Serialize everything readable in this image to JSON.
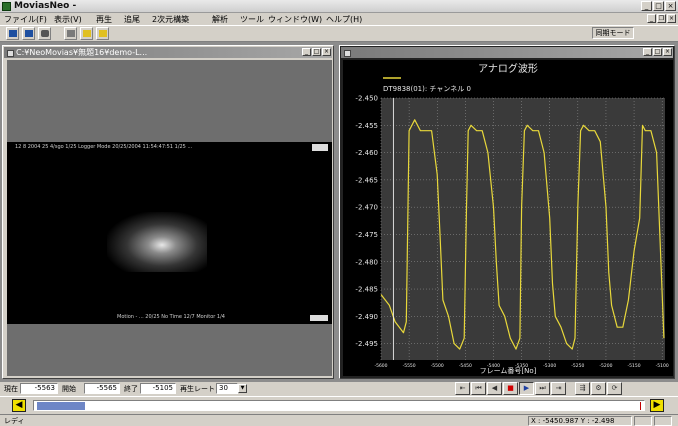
{
  "app": {
    "title": "MoviasNeo -"
  },
  "menubar": {
    "items": [
      "ファイル(F)",
      "表示(V)",
      "再生",
      "追尾",
      "2次元構築",
      "解析",
      "ツール",
      "ウィンドウ(W)",
      "ヘルプ(H)"
    ]
  },
  "toolbar": {
    "sync_mode": "同期モード"
  },
  "video_window": {
    "title": "C:¥NeoMovias¥無題16¥demo-L...",
    "osd_top": "12 8 2004   25 4/sgo   1/25   Logger Mode  20/25/2004  11:54:47:51    1/25 ... ",
    "osd_bottom": "Motion - ...   20/25 No Time  12/7   Monitor 1/4"
  },
  "chart_window": {
    "title": "",
    "cursor": {
      "x": 9,
      "y": 1
    }
  },
  "chart_data": {
    "type": "line",
    "title": "アナログ波形",
    "legend": "DT9838(01): チャンネル 0",
    "xlabel": "フレーム番号[No]",
    "ylabel": "",
    "ylim": [
      -2.498,
      -2.45
    ],
    "xlim": [
      -5600,
      -5095
    ],
    "yticks": [
      -2.45,
      -2.455,
      -2.46,
      -2.465,
      -2.47,
      -2.475,
      -2.48,
      -2.485,
      -2.49,
      -2.495
    ],
    "xticks": [
      "-5600",
      "-5550",
      "-5500",
      "-5450",
      "-5400",
      "-5350",
      "-5300",
      "-5250",
      "-5200",
      "-5150",
      "-5100"
    ],
    "grid": true,
    "colors": {
      "line": "#e8d83a",
      "plot_bg": "#3a3a3a",
      "grid": "#9a9a9a",
      "text": "#e6e6e6"
    },
    "series": [
      {
        "name": "",
        "x": [
          -5600,
          -5585,
          -5575,
          -5560,
          -5555,
          -5550,
          -5540,
          -5530,
          -5520,
          -5510,
          -5500,
          -5495,
          -5490,
          -5480,
          -5470,
          -5460,
          -5452,
          -5448,
          -5445,
          -5440,
          -5430,
          -5420,
          -5410,
          -5400,
          -5395,
          -5390,
          -5380,
          -5370,
          -5360,
          -5353,
          -5350,
          -5345,
          -5340,
          -5330,
          -5320,
          -5310,
          -5300,
          -5295,
          -5290,
          -5280,
          -5270,
          -5260,
          -5255,
          -5250,
          -5245,
          -5240,
          -5230,
          -5220,
          -5210,
          -5200,
          -5195,
          -5190,
          -5185,
          -5180,
          -5170,
          -5160,
          -5150,
          -5145,
          -5140,
          -5135,
          -5130,
          -5120,
          -5110,
          -5100,
          -5097
        ],
        "values": [
          -2.486,
          -2.488,
          -2.491,
          -2.493,
          -2.491,
          -2.456,
          -2.454,
          -2.456,
          -2.456,
          -2.456,
          -2.464,
          -2.475,
          -2.487,
          -2.49,
          -2.495,
          -2.496,
          -2.494,
          -2.47,
          -2.456,
          -2.455,
          -2.456,
          -2.456,
          -2.46,
          -2.47,
          -2.48,
          -2.488,
          -2.49,
          -2.494,
          -2.496,
          -2.494,
          -2.47,
          -2.456,
          -2.455,
          -2.456,
          -2.456,
          -2.46,
          -2.472,
          -2.484,
          -2.49,
          -2.492,
          -2.495,
          -2.496,
          -2.494,
          -2.47,
          -2.456,
          -2.455,
          -2.456,
          -2.456,
          -2.458,
          -2.47,
          -2.482,
          -2.488,
          -2.49,
          -2.492,
          -2.492,
          -2.487,
          -2.478,
          -2.475,
          -2.472,
          -2.455,
          -2.456,
          -2.456,
          -2.46,
          -2.486,
          -2.494
        ]
      }
    ]
  },
  "statusrow": {
    "current_label": "現在",
    "current_value": "-5563",
    "start_label": "開始",
    "start_value": "-5565",
    "end_label": "終了",
    "end_value": "-5105",
    "rate_label": "再生レート",
    "rate_value": "30"
  },
  "playback": {
    "buttons": [
      "⇤",
      "⏮",
      "◀",
      "■",
      "▶",
      "⏭",
      "⇥",
      "⇶",
      "⚙",
      "⟳"
    ]
  },
  "timeline": {
    "left_arrow": "◀",
    "right_arrow": "▶",
    "position_fraction": 0.005
  },
  "statusbar": {
    "ready": "レディ",
    "coords": "X : -5450.987  Y : -2.498"
  }
}
